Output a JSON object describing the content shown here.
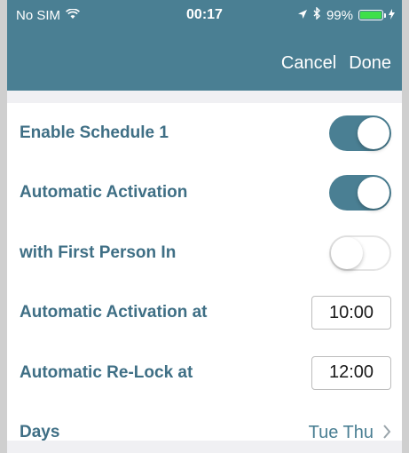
{
  "statusbar": {
    "carrier": "No SIM",
    "time": "00:17",
    "battery_percent": "99%",
    "battery_level": 0.99,
    "icons": [
      "wifi-icon",
      "location-arrow-icon",
      "bluetooth-icon",
      "battery-icon"
    ]
  },
  "navbar": {
    "cancel_label": "Cancel",
    "done_label": "Done"
  },
  "settings": {
    "enable_schedule": {
      "label": "Enable Schedule 1",
      "on": true
    },
    "automatic_activation": {
      "label": "Automatic Activation",
      "on": true
    },
    "first_person_in": {
      "label": "with First Person In",
      "on": false
    },
    "activation_at": {
      "label": "Automatic Activation at",
      "value": "10:00"
    },
    "relock_at": {
      "label": "Automatic Re-Lock at",
      "value": "12:00"
    },
    "days": {
      "label": "Days",
      "value": "Tue Thu"
    }
  },
  "colors": {
    "accent": "#4a7f93",
    "label_text": "#3f6f85",
    "battery_green": "#3ee04a"
  }
}
